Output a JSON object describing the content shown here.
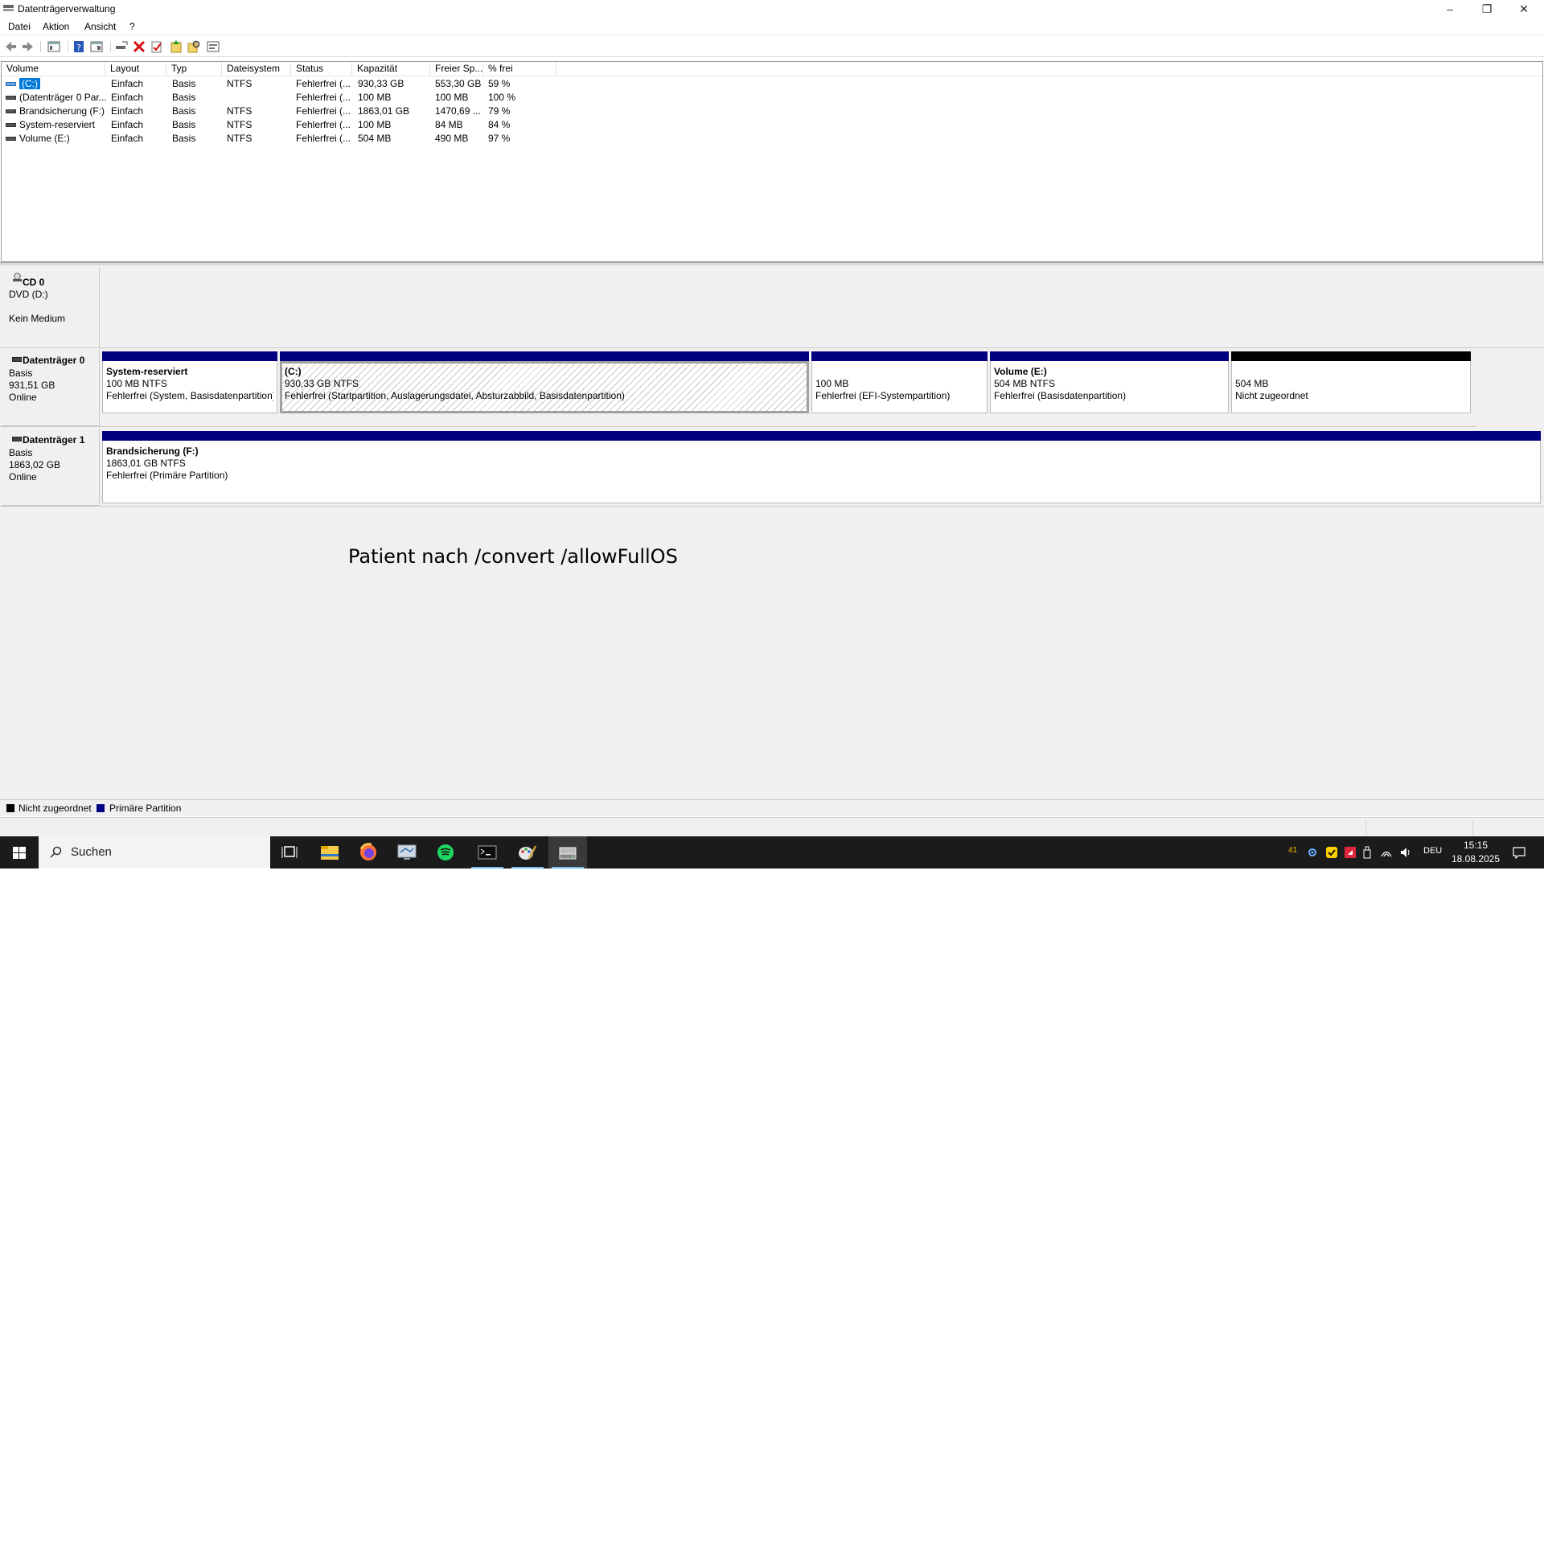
{
  "window": {
    "title": "Datenträgerverwaltung"
  },
  "menu": {
    "items": [
      "Datei",
      "Aktion",
      "Ansicht",
      "?"
    ]
  },
  "toolbar": {
    "icons": [
      "back-icon",
      "forward-icon",
      "console-tree-icon",
      "help-icon",
      "properties-icon",
      "connect-icon",
      "delete-icon",
      "check-icon",
      "import-icon",
      "search-disk-icon",
      "settings-icon"
    ]
  },
  "volume_list": {
    "columns": [
      "Volume",
      "Layout",
      "Typ",
      "Dateisystem",
      "Status",
      "Kapazität",
      "Freier Sp...",
      "% frei"
    ],
    "rows": [
      {
        "volume": "(C:)",
        "layout": "Einfach",
        "type": "Basis",
        "fs": "NTFS",
        "status": "Fehlerfrei (...",
        "capacity": "930,33 GB",
        "free": "553,30 GB",
        "pct": "59 %"
      },
      {
        "volume": "(Datenträger 0 Par...",
        "layout": "Einfach",
        "type": "Basis",
        "fs": "",
        "status": "Fehlerfrei (...",
        "capacity": "100 MB",
        "free": "100 MB",
        "pct": "100 %"
      },
      {
        "volume": "Brandsicherung (F:)",
        "layout": "Einfach",
        "type": "Basis",
        "fs": "NTFS",
        "status": "Fehlerfrei (...",
        "capacity": "1863,01 GB",
        "free": "1470,69 ...",
        "pct": "79 %"
      },
      {
        "volume": "System-reserviert",
        "layout": "Einfach",
        "type": "Basis",
        "fs": "NTFS",
        "status": "Fehlerfrei (...",
        "capacity": "100 MB",
        "free": "84 MB",
        "pct": "84 %"
      },
      {
        "volume": "Volume (E:)",
        "layout": "Einfach",
        "type": "Basis",
        "fs": "NTFS",
        "status": "Fehlerfrei (...",
        "capacity": "504 MB",
        "free": "490 MB",
        "pct": "97 %"
      }
    ]
  },
  "disks": {
    "cd0": {
      "name": "CD 0",
      "line1": "DVD (D:)",
      "line2": "Kein Medium"
    },
    "disk0": {
      "name": "Datenträger 0",
      "type": "Basis",
      "size": "931,51 GB",
      "state": "Online",
      "partitions": [
        {
          "name": "System-reserviert",
          "size": "100 MB NTFS",
          "status": "Fehlerfrei (System, Basisdatenpartition)"
        },
        {
          "name": "(C:)",
          "size": "930,33 GB NTFS",
          "status": "Fehlerfrei (Startpartition, Auslagerungsdatei, Absturzabbild, Basisdatenpartition)"
        },
        {
          "name": "",
          "size": "100 MB",
          "status": "Fehlerfrei (EFI-Systempartition)"
        },
        {
          "name": "Volume  (E:)",
          "size": "504 MB NTFS",
          "status": "Fehlerfrei (Basisdatenpartition)"
        },
        {
          "name": "",
          "size": "504 MB",
          "status": "Nicht zugeordnet"
        }
      ]
    },
    "disk1": {
      "name": "Datenträger 1",
      "type": "Basis",
      "size": "1863,02 GB",
      "state": "Online",
      "partitions": [
        {
          "name": "Brandsicherung  (F:)",
          "size": "1863,01 GB NTFS",
          "status": "Fehlerfrei (Primäre Partition)"
        }
      ]
    }
  },
  "annotation": "Patient nach /convert /allowFullOS",
  "legend": {
    "unallocated": "Nicht zugeordnet",
    "primary": "Primäre Partition"
  },
  "colors": {
    "primary_partition": "#000080",
    "unallocated": "#000000",
    "selection": "#0078d7",
    "taskbar": "#1b1b1b"
  },
  "taskbar": {
    "search_placeholder": "Suchen",
    "apps": [
      "task-view-icon",
      "file-explorer-icon",
      "firefox-icon",
      "remote-desktop-icon",
      "spotify-icon",
      "terminal-icon",
      "paint-icon",
      "disk-management-icon"
    ],
    "tray": {
      "badge": "41",
      "language": "DEU"
    },
    "clock": {
      "time": "15:15",
      "date": "18.08.2025"
    }
  }
}
